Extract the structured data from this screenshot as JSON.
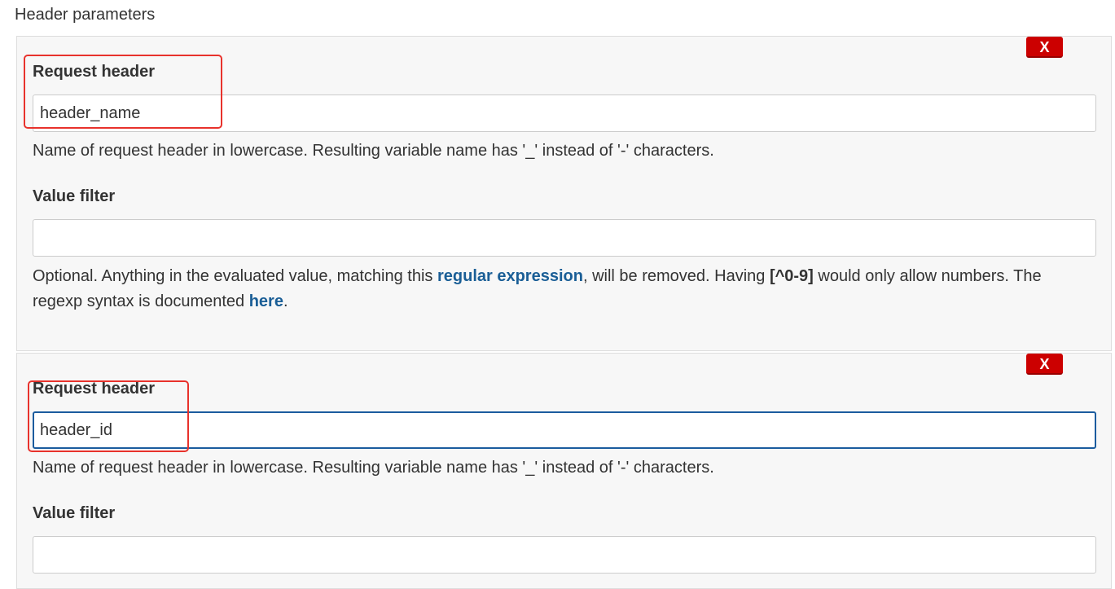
{
  "section": {
    "title": "Header parameters"
  },
  "remove_label": "X",
  "header_1": {
    "label": "Request header",
    "value": "header_name",
    "help": "Name of request header in lowercase. Resulting variable name has '_' instead of '-' characters.",
    "filter_label": "Value filter",
    "filter_value": "",
    "filter_help": {
      "part1": "Optional. Anything in the evaluated value, matching this ",
      "link1": "regular expression",
      "part2": ", will be removed. Having ",
      "code": "[^0-9]",
      "part3": " would only allow numbers. The regexp syntax is documented ",
      "link2": "here",
      "part4": "."
    }
  },
  "header_2": {
    "label": "Request header",
    "value": "header_id",
    "help": "Name of request header in lowercase. Resulting variable name has '_' instead of '-' characters.",
    "filter_label": "Value filter",
    "filter_value": ""
  }
}
